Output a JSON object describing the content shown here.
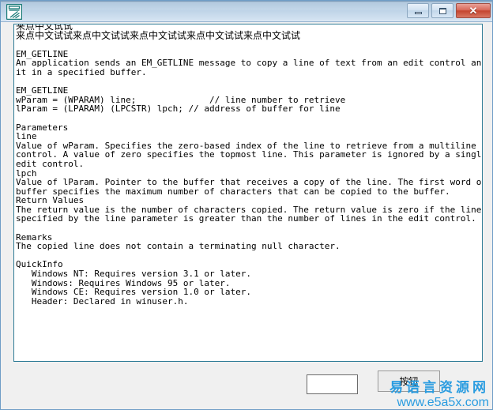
{
  "window": {
    "title": "",
    "icon": "easy-language-logo-icon",
    "frame_border_color": "#6f9dc6",
    "client_background": "#f0f0f0"
  },
  "caption_buttons": {
    "minimize_label": "minimize",
    "maximize_label": "maximize",
    "close_label": "✕",
    "close_color": "#c4452f"
  },
  "editor": {
    "border_color": "#2f7c96",
    "lines": [
      "来点中文试试",
      "来点中文试试来点中文试试来点中文试试来点中文试试来点中文试试",
      "",
      "EM_GETLINE",
      "An application sends an EM_GETLINE message to copy a line of text from an edit control and place",
      "it in a specified buffer.",
      "",
      "EM_GETLINE",
      "wParam = (WPARAM) line;              // line number to retrieve",
      "lParam = (LPARAM) (LPCSTR) lpch; // address of buffer for line",
      "",
      "Parameters",
      "line",
      "Value of wParam. Specifies the zero-based index of the line to retrieve from a multiline edit",
      "control. A value of zero specifies the topmost line. This parameter is ignored by a single-line",
      "edit control.",
      "lpch",
      "Value of lParam. Pointer to the buffer that receives a copy of the line. The first word of the",
      "buffer specifies the maximum number of characters that can be copied to the buffer.",
      "Return Values",
      "The return value is the number of characters copied. The return value is zero if the line number",
      "specified by the line parameter is greater than the number of lines in the edit control.",
      "",
      "Remarks",
      "The copied line does not contain a terminating null character.",
      "",
      "QuickInfo",
      "   Windows NT: Requires version 3.1 or later.",
      "   Windows: Requires Windows 95 or later.",
      "   Windows CE: Requires version 1.0 or later.",
      "   Header: Declared in winuser.h."
    ]
  },
  "bottom": {
    "input_value": "",
    "input_placeholder": "",
    "button_label": "按钮"
  },
  "watermark": {
    "site_name": "易语言资源网",
    "url": "www.e5a5x.com",
    "color": "#2a9ce0"
  }
}
